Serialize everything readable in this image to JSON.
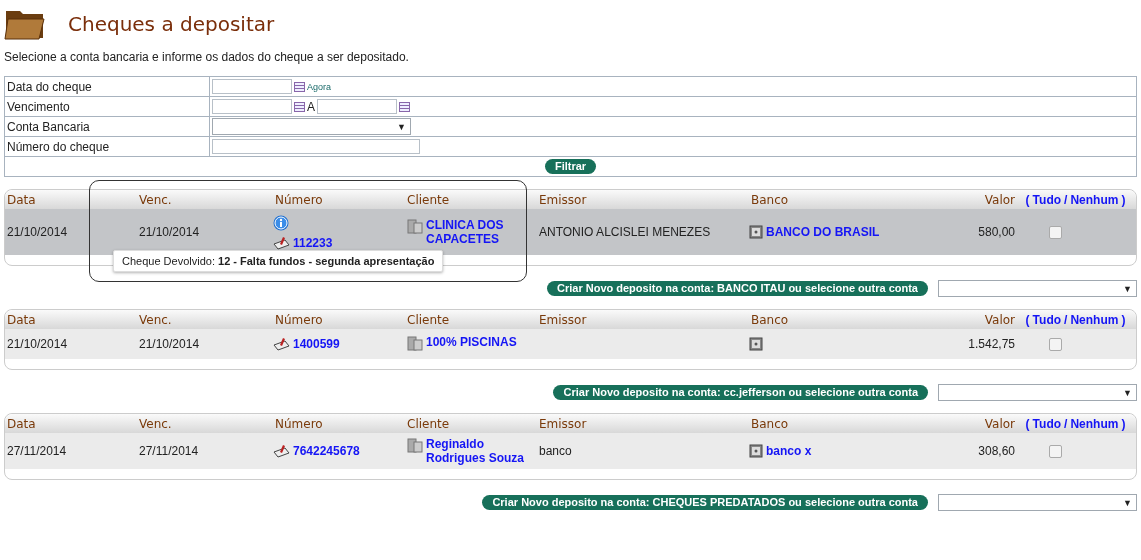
{
  "title": "Cheques a depositar",
  "subtitle": "Selecione a conta bancaria e informe os dados do cheque a ser depositado.",
  "filter": {
    "fields": [
      {
        "label": "Data do cheque",
        "kind": "date",
        "link": "Agora"
      },
      {
        "label": "Vencimento",
        "kind": "range",
        "separator": "A"
      },
      {
        "label": "Conta Bancaria",
        "kind": "select",
        "arrow": "▼"
      },
      {
        "label": "Número do cheque",
        "kind": "text"
      }
    ],
    "button": "Filtrar"
  },
  "groups": [
    {
      "columns": [
        "Data",
        "Venc.",
        "Número",
        "Cliente",
        "Emissor",
        "Banco",
        "Valor"
      ],
      "select_all": {
        "open": "(",
        "all": "Tudo",
        "sep": "/",
        "none": "Nenhum",
        "close": ")"
      },
      "rows": [
        {
          "data": "21/10/2014",
          "venc": "21/10/2014",
          "numero": "112233",
          "cliente": "CLINICA DOS CAPACETES",
          "emissor": "ANTONIO ALCISLEI MENEZES",
          "banco": "BANCO DO BRASIL",
          "valor": "580,00",
          "checked": false,
          "highlighted": true,
          "returned": true,
          "tooltip": "Cheque Devolvido: **12 - Falta fundos - segunda apresentação**"
        }
      ],
      "action": "Criar Novo deposito na conta: BANCO ITAU ou selecione outra conta",
      "select_arrow": "▼"
    },
    {
      "columns": [
        "Data",
        "Venc.",
        "Número",
        "Cliente",
        "Emissor",
        "Banco",
        "Valor"
      ],
      "select_all": {
        "open": "(",
        "all": "Tudo",
        "sep": "/",
        "none": "Nenhum",
        "close": ")"
      },
      "rows": [
        {
          "data": "21/10/2014",
          "venc": "21/10/2014",
          "numero": "1400599",
          "cliente": "100% PISCINAS",
          "banco_icon": true,
          "valor": "1.542,75",
          "checked": false,
          "highlighted": false,
          "returned": false
        }
      ],
      "action": "Criar Novo deposito na conta: cc.jefferson ou selecione outra conta",
      "select_arrow": "▼"
    },
    {
      "columns": [
        "Data",
        "Venc.",
        "Número",
        "Cliente",
        "Emissor",
        "Banco",
        "Valor"
      ],
      "select_all": {
        "open": "(",
        "all": "Tudo",
        "sep": "/",
        "none": "Nenhum",
        "close": ")"
      },
      "rows": [
        {
          "data": "27/11/2014",
          "venc": "27/11/2014",
          "numero": "7642245678",
          "cliente": "Reginaldo Rodrigues Souza",
          "emissor": "banco",
          "banco": "banco x",
          "valor": "308,60",
          "checked": false,
          "highlighted": false,
          "returned": false
        }
      ],
      "action": "Criar Novo deposito na conta: CHEQUES PREDATADOS ou selecione outra conta",
      "select_arrow": "▼"
    }
  ]
}
